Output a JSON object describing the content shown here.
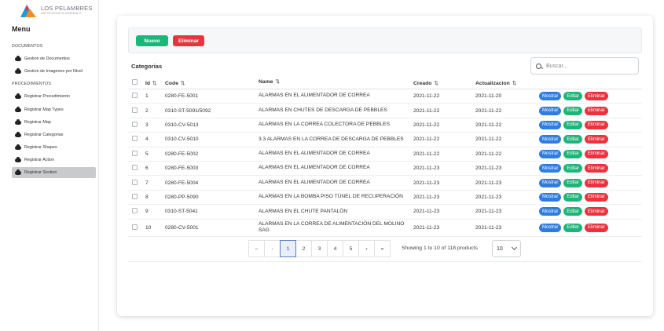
{
  "brand": {
    "name": "LOS PELAMBRES",
    "subtitle": "ANTOFAGASTA MINERALS"
  },
  "sidebar": {
    "title": "Menu",
    "sections": [
      {
        "heading": "DOCUMENTOS",
        "items": [
          "Gestion de Documentos",
          "Gestion de Imagenes por Nivel"
        ]
      },
      {
        "heading": "PROCEDIMIENTOS",
        "items": [
          "Registrar Procedimiento",
          "Registrar Map Types",
          "Registrar Map",
          "Registrar Categorias",
          "Registrar Shapes",
          "Registrar Action",
          "Registrar Section"
        ]
      }
    ],
    "active_item": "Registrar Section"
  },
  "toolbar": {
    "new_label": "Nuevo",
    "delete_label": "Eliminar"
  },
  "table_title": "Categorias",
  "search": {
    "placeholder": "Buscar..."
  },
  "columns": [
    "Id",
    "Code",
    "Name",
    "Creado",
    "Actualizacion"
  ],
  "actions": {
    "show": "Mostrar",
    "edit": "Editar",
    "delete": "Eliminar"
  },
  "rows": [
    {
      "id": "1",
      "code": "0280-FE-5001",
      "name": "ALARMAS EN EL ALIMENTADOR DE CORREA",
      "created": "2021-11-22",
      "updated": "2021-11-20"
    },
    {
      "id": "2",
      "code": "0310-ST-5091/5092",
      "name": "ALARMAS EN CHUTES DE DESCARGA DE PEBBLES",
      "created": "2021-11-22",
      "updated": "2021-11-22"
    },
    {
      "id": "3",
      "code": "0310-CV-5013",
      "name": "ALARMAS EN LA CORREA COLECTORA DE PEBBLES",
      "created": "2021-11-22",
      "updated": "2021-11-22"
    },
    {
      "id": "4",
      "code": "0310-CV-5010",
      "name": "3.3 ALARMAS EN LA CORREA DE DESCARGA DE PEBBLES",
      "created": "2021-11-22",
      "updated": "2021-11-22"
    },
    {
      "id": "5",
      "code": "0280-FE-5002",
      "name": "ALARMAS EN EL ALIMENTADOR DE CORREA",
      "created": "2021-11-22",
      "updated": "2021-11-22"
    },
    {
      "id": "6",
      "code": "0280-FE-5003",
      "name": "ALARMAS EN EL ALIMENTADOR DE CORREA",
      "created": "2021-11-23",
      "updated": "2021-11-23"
    },
    {
      "id": "7",
      "code": "0280-FE-5004",
      "name": "ALARMAS EN EL ALIMENTADOR DE CORREA",
      "created": "2021-11-23",
      "updated": "2021-11-23"
    },
    {
      "id": "8",
      "code": "0280-PP-5090",
      "name": "ALARMAS EN LA BOMBA PISO TÚNEL DE RECUPERACIÓN",
      "created": "2021-11-23",
      "updated": "2021-11-23"
    },
    {
      "id": "9",
      "code": "0310-ST-5041",
      "name": "ALARMAS EN EL CHUTE PANTALÓN",
      "created": "2021-11-23",
      "updated": "2021-11-23"
    },
    {
      "id": "10",
      "code": "0280-CV-5001",
      "name": "ALARMAS EN LA CORREA DE ALIMENTACIÓN DEL MOLINO SAG",
      "created": "2021-11-23",
      "updated": "2021-11-23"
    }
  ],
  "pagination": {
    "first": "«",
    "prev": "‹",
    "next": "›",
    "last": "»",
    "pages": [
      "1",
      "2",
      "3",
      "4",
      "5"
    ],
    "current": "1",
    "info": "Showing 1 to 10 of 118 products",
    "per_page": "10"
  },
  "colors": {
    "primary": "#2f7de1",
    "success": "#1fb57a",
    "danger": "#e9343f"
  }
}
